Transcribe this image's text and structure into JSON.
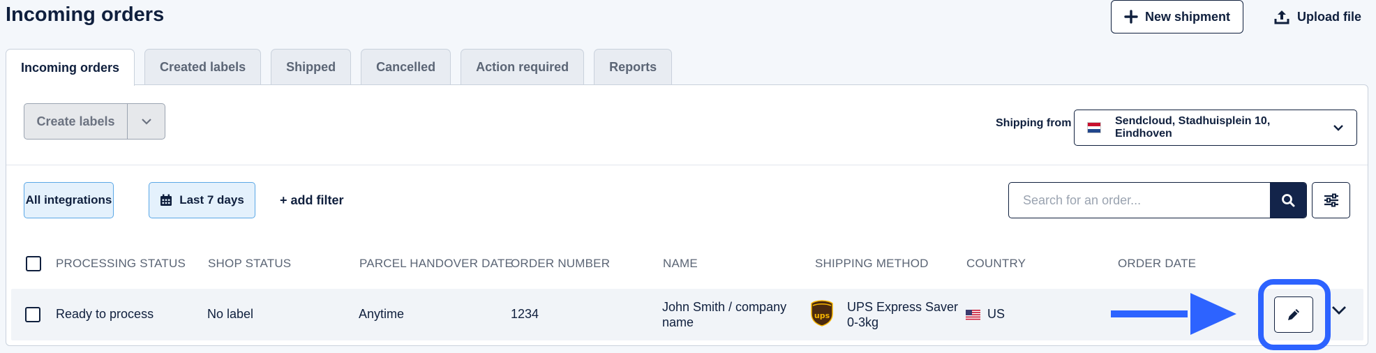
{
  "header": {
    "title": "Incoming orders",
    "new_shipment_label": "New shipment",
    "upload_file_label": "Upload file"
  },
  "tabs": [
    {
      "label": "Incoming orders",
      "active": true
    },
    {
      "label": "Created labels",
      "active": false
    },
    {
      "label": "Shipped",
      "active": false
    },
    {
      "label": "Cancelled",
      "active": false
    },
    {
      "label": "Action required",
      "active": false
    },
    {
      "label": "Reports",
      "active": false
    }
  ],
  "toolbar": {
    "create_labels_label": "Create labels",
    "shipping_from_label": "Shipping from",
    "shipping_from_value": "Sendcloud, Stadhuisplein 10, Eindhoven"
  },
  "filters": {
    "integrations_label": "All integrations",
    "date_label": "Last 7 days",
    "add_filter_label": "+ add filter",
    "search_placeholder": "Search for an order..."
  },
  "table": {
    "columns": [
      "PROCESSING STATUS",
      "SHOP STATUS",
      "PARCEL HANDOVER DATE",
      "ORDER NUMBER",
      "NAME",
      "SHIPPING METHOD",
      "COUNTRY",
      "ORDER DATE"
    ],
    "rows": [
      {
        "processing_status": "Ready to process",
        "shop_status": "No label",
        "handover_date": "Anytime",
        "order_number": "1234",
        "name": "John Smith / company name",
        "shipping_method": "UPS Express Saver 0-3kg",
        "country": "US",
        "order_date": ""
      }
    ]
  },
  "colors": {
    "brand_navy": "#13244a",
    "highlight_blue": "#2d63ff",
    "chip_border": "#5aa7e6"
  },
  "icons": [
    "plus-icon",
    "upload-icon",
    "chevron-down-icon",
    "calendar-icon",
    "search-icon",
    "sliders-icon",
    "nl-flag-icon",
    "ups-logo-icon",
    "us-flag-icon",
    "pencil-icon",
    "arrow-right-icon"
  ]
}
